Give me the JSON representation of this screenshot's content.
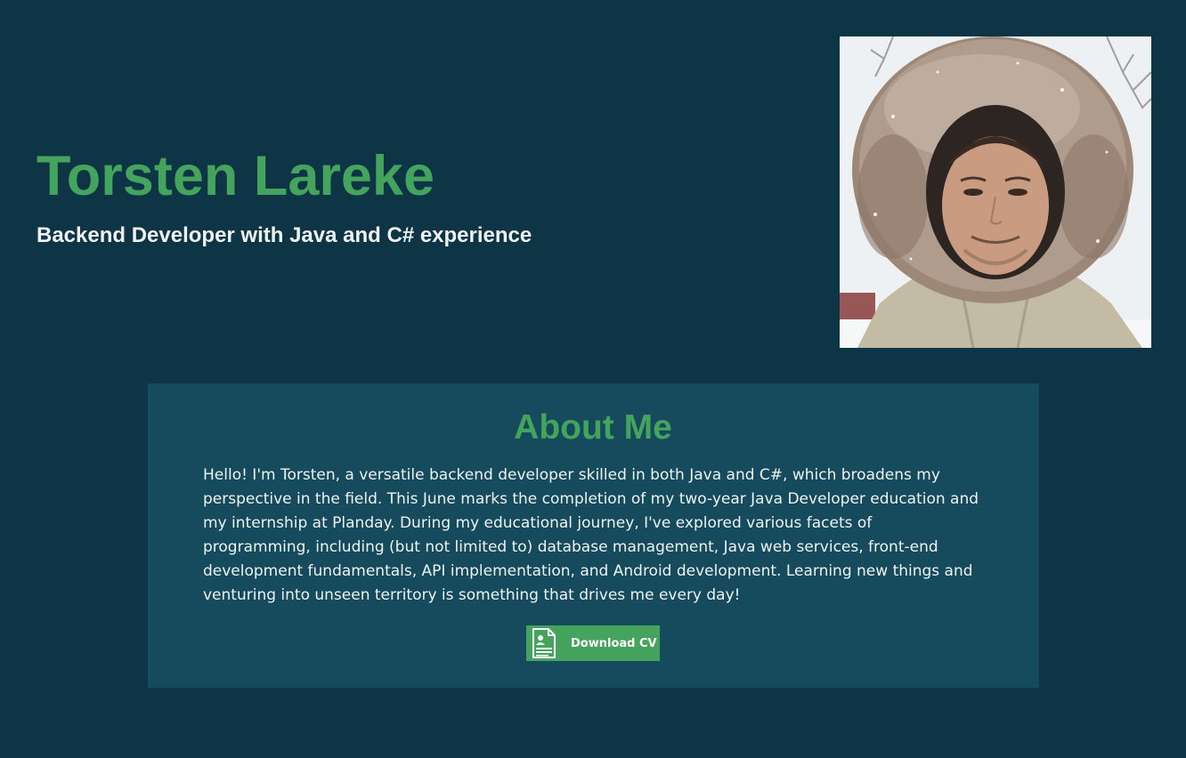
{
  "hero": {
    "name": "Torsten Lareke",
    "tagline": "Backend Developer with Java and C# experience"
  },
  "portrait": {
    "icon": "profile-photo",
    "colors": {
      "background": "#eef1f3",
      "fur": "#a08c7e",
      "jacket": "#c3bba3",
      "skin": "#c99b80"
    }
  },
  "about": {
    "title": "About Me",
    "text": "Hello! I'm Torsten, a versatile backend developer skilled in both Java and C#, which broadens my perspective in the field. This June marks the completion of my two-year Java Developer education and my internship at Planday. During my educational journey, I've explored various facets of programming, including (but not limited to) database management, Java web services, front-end development fundamentals, API implementation, and Android development. Learning new things and venturing into unseen territory is something that drives me every day!",
    "button": {
      "label": "Download CV",
      "icon": "resume-document-icon"
    }
  },
  "colors": {
    "page_background": "#0e3545",
    "card_background": "#154b5c",
    "accent": "#44a35c",
    "text": "#eef2f0"
  }
}
